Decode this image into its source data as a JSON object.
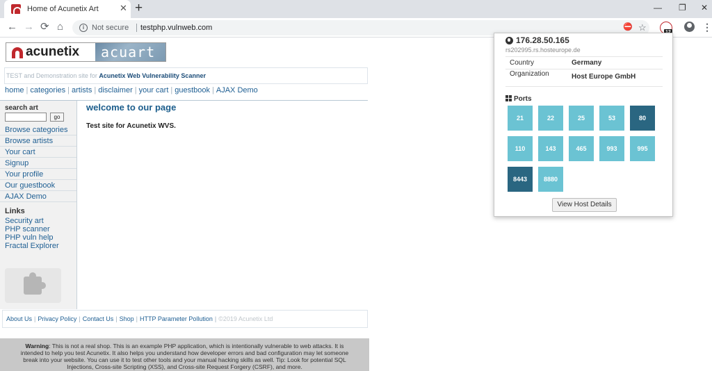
{
  "browser": {
    "tab_title": "Home of Acunetix Art",
    "tab_close": "✕",
    "new_tab": "+",
    "window_controls": {
      "minimize": "—",
      "restore": "❐",
      "close": "✕"
    },
    "nav": {
      "back": "←",
      "forward": "→",
      "reload": "⟳",
      "home": "⌂"
    },
    "security_label": "Not secure",
    "url": "testphp.vulnweb.com",
    "omnibox_icons": {
      "site_settings": "⛔",
      "star": "☆"
    },
    "extension_badge": "12",
    "menu": "⋮"
  },
  "site": {
    "logo_left": "acunetix",
    "logo_right": "acuart",
    "tagline_prefix": "TEST and Demonstration site for ",
    "tagline_link": "Acunetix Web Vulnerability Scanner",
    "topnav": [
      "home",
      "categories",
      "artists",
      "disclaimer",
      "your cart",
      "guestbook",
      "AJAX Demo"
    ],
    "topnav_sep": "|",
    "search": {
      "title": "search art",
      "go": "go",
      "value": ""
    },
    "leftmenu": [
      "Browse categories",
      "Browse artists",
      "Your cart",
      "Signup",
      "Your profile",
      "Our guestbook",
      "AJAX Demo"
    ],
    "links_title": "Links",
    "links": [
      "Security art",
      "PHP scanner",
      "PHP vuln help",
      "Fractal Explorer"
    ],
    "welcome_title": "welcome to our page",
    "welcome_text": "Test site for Acunetix WVS.",
    "footer_links": [
      "About Us",
      "Privacy Policy",
      "Contact Us",
      "Shop",
      "HTTP Parameter Pollution"
    ],
    "footer_copy": "©2019 Acunetix Ltd",
    "warning_label": "Warning",
    "warning_text": ": This is not a real shop. This is an example PHP application, which is intentionally vulnerable to web attacks. It is intended to help you test Acunetix. It also helps you understand how developer errors and bad configuration may let someone break into your website. You can use it to test other tools and your manual hacking skills as well. Tip: Look for potential SQL Injections, Cross-site Scripting (XSS), and Cross-site Request Forgery (CSRF), and more."
  },
  "popup": {
    "ip": "176.28.50.165",
    "hostname": "rs202995.rs.hosteurope.de",
    "rows": [
      {
        "label": "Country",
        "value": "Germany"
      },
      {
        "label": "Organization",
        "value": "Host Europe GmbH"
      }
    ],
    "ports_title": "Ports",
    "ports": [
      {
        "number": "21",
        "highlighted": false
      },
      {
        "number": "22",
        "highlighted": false
      },
      {
        "number": "25",
        "highlighted": false
      },
      {
        "number": "53",
        "highlighted": false
      },
      {
        "number": "80",
        "highlighted": true
      },
      {
        "number": "110",
        "highlighted": false
      },
      {
        "number": "143",
        "highlighted": false
      },
      {
        "number": "465",
        "highlighted": false
      },
      {
        "number": "993",
        "highlighted": false
      },
      {
        "number": "995",
        "highlighted": false
      },
      {
        "number": "8443",
        "highlighted": true
      },
      {
        "number": "8880",
        "highlighted": false
      }
    ],
    "view_button": "View Host Details",
    "colors": {
      "port": "#6bc3d3",
      "port_highlighted": "#2a6681"
    }
  }
}
